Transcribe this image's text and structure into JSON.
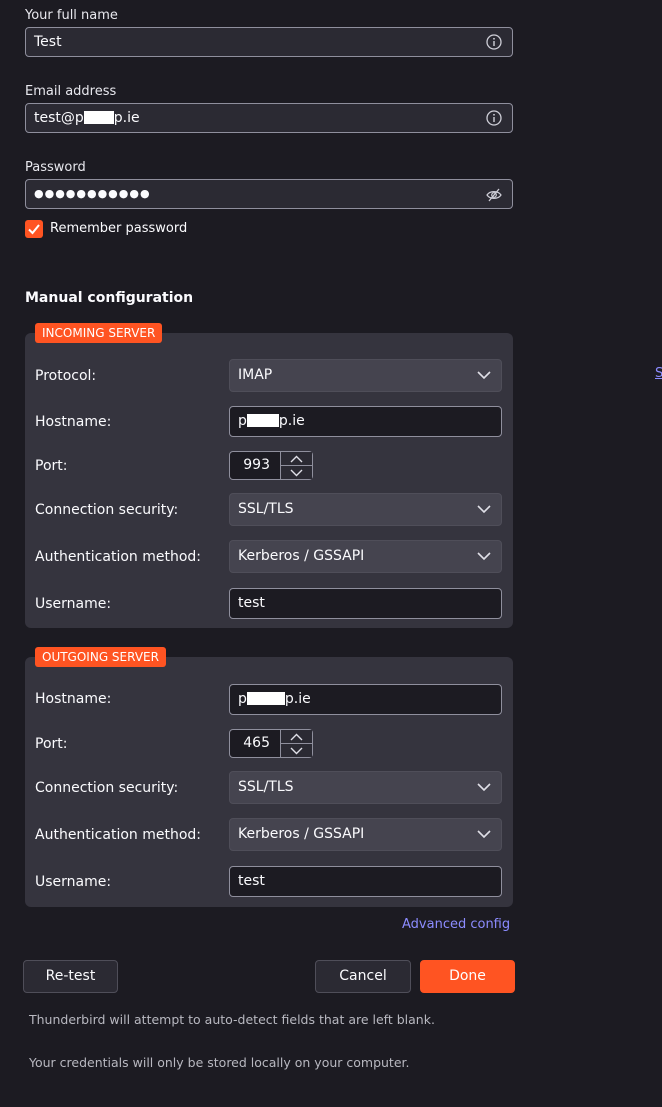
{
  "account": {
    "name_label": "Your full name",
    "name_value": "Test",
    "email_label": "Email address",
    "email_prefix": "test@p",
    "email_suffix": "p.ie",
    "password_label": "Password",
    "password_value": "●●●●●●●●●●●",
    "remember_label": "Remember password",
    "remember_checked": true
  },
  "manual": {
    "title": "Manual configuration",
    "incoming": {
      "badge": "INCOMING SERVER",
      "protocol_label": "Protocol:",
      "protocol_value": "IMAP",
      "hostname_label": "Hostname:",
      "hostname_prefix": "p",
      "hostname_suffix": "p.ie",
      "port_label": "Port:",
      "port_value": "993",
      "security_label": "Connection security:",
      "security_value": "SSL/TLS",
      "auth_label": "Authentication method:",
      "auth_value": "Kerberos / GSSAPI",
      "username_label": "Username:",
      "username_value": "test"
    },
    "outgoing": {
      "badge": "OUTGOING SERVER",
      "hostname_label": "Hostname:",
      "hostname_prefix": "p",
      "hostname_suffix": "p.ie",
      "port_label": "Port:",
      "port_value": "465",
      "security_label": "Connection security:",
      "security_value": "SSL/TLS",
      "auth_label": "Authentication method:",
      "auth_value": "Kerberos / GSSAPI",
      "username_label": "Username:",
      "username_value": "test"
    },
    "advanced_link": "Advanced config"
  },
  "buttons": {
    "retest": "Re-test",
    "cancel": "Cancel",
    "done": "Done"
  },
  "notes": {
    "autodetect": "Thunderbird will attempt to auto-detect fields that are left blank.",
    "credentials": "Your credentials will only be stored locally on your computer."
  },
  "side_glyph": "S",
  "colors": {
    "background": "#1c1b22",
    "accent": "#ff5422",
    "link": "#8c8cff",
    "panel": "#35343e"
  }
}
